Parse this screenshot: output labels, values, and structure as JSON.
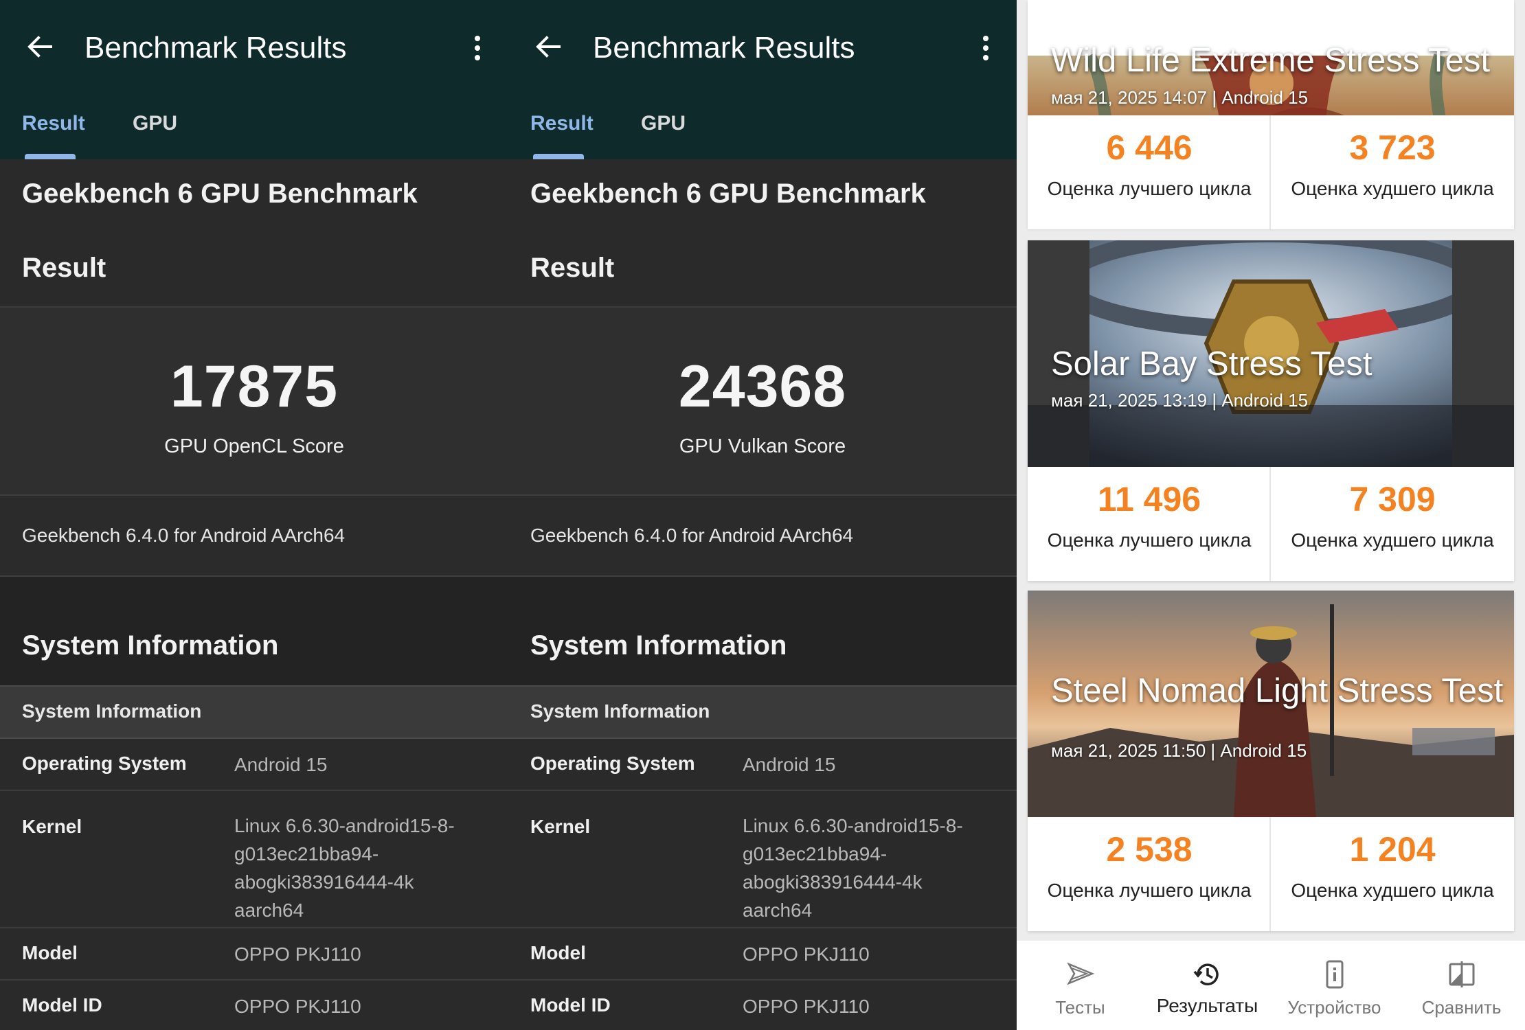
{
  "geekbench_panels": [
    {
      "appbar": {
        "title": "Benchmark Results"
      },
      "tabs": {
        "result": "Result",
        "gpu": "GPU"
      },
      "benchmark_title": "Geekbench 6 GPU Benchmark",
      "result_title": "Result",
      "score": {
        "value": "17875",
        "label": "GPU OpenCL Score"
      },
      "version": "Geekbench 6.4.0 for Android AArch64",
      "system_information": {
        "title": "System Information",
        "subheader": "System Information",
        "rows": {
          "os": {
            "key": "Operating System",
            "value": "Android 15"
          },
          "kernel": {
            "key": "Kernel",
            "value": "Linux 6.6.30-android15-8-\ng013ec21bba94-\nabogki383916444-4k\naarch64"
          },
          "model": {
            "key": "Model",
            "value": "OPPO PKJ110"
          },
          "model_id": {
            "key": "Model ID",
            "value": "OPPO PKJ110"
          }
        }
      }
    },
    {
      "appbar": {
        "title": "Benchmark Results"
      },
      "tabs": {
        "result": "Result",
        "gpu": "GPU"
      },
      "benchmark_title": "Geekbench 6 GPU Benchmark",
      "result_title": "Result",
      "score": {
        "value": "24368",
        "label": "GPU Vulkan Score"
      },
      "version": "Geekbench 6.4.0 for Android AArch64",
      "system_information": {
        "title": "System Information",
        "subheader": "System Information",
        "rows": {
          "os": {
            "key": "Operating System",
            "value": "Android 15"
          },
          "kernel": {
            "key": "Kernel",
            "value": "Linux 6.6.30-android15-8-\ng013ec21bba94-\nabogki383916444-4k\naarch64"
          },
          "model": {
            "key": "Model",
            "value": "OPPO PKJ110"
          },
          "model_id": {
            "key": "Model ID",
            "value": "OPPO PKJ110"
          }
        }
      }
    }
  ],
  "threedmark": {
    "accent_color": "#f58220",
    "cards": [
      {
        "name": "Wild Life Extreme Stress Test",
        "date": "мая 21, 2025 14:07 | Android 15",
        "best": {
          "value": "6 446",
          "label": "Оценка лучшего цикла"
        },
        "worst": {
          "value": "3 723",
          "label": "Оценка худшего цикла"
        }
      },
      {
        "name": "Solar Bay Stress Test",
        "date": "мая 21, 2025 13:19 | Android 15",
        "best": {
          "value": "11 496",
          "label": "Оценка лучшего цикла"
        },
        "worst": {
          "value": "7 309",
          "label": "Оценка худшего цикла"
        }
      },
      {
        "name": "Steel Nomad Light Stress Test",
        "date": "мая 21, 2025 11:50 | Android 15",
        "best": {
          "value": "2 538",
          "label": "Оценка лучшего цикла"
        },
        "worst": {
          "value": "1 204",
          "label": "Оценка худшего цикла"
        }
      }
    ],
    "nav": [
      {
        "label": "Тесты",
        "icon": "tests-icon"
      },
      {
        "label": "Результаты",
        "icon": "history-icon",
        "active": true
      },
      {
        "label": "Устройство",
        "icon": "device-info-icon"
      },
      {
        "label": "Сравнить",
        "icon": "compare-icon"
      }
    ]
  }
}
